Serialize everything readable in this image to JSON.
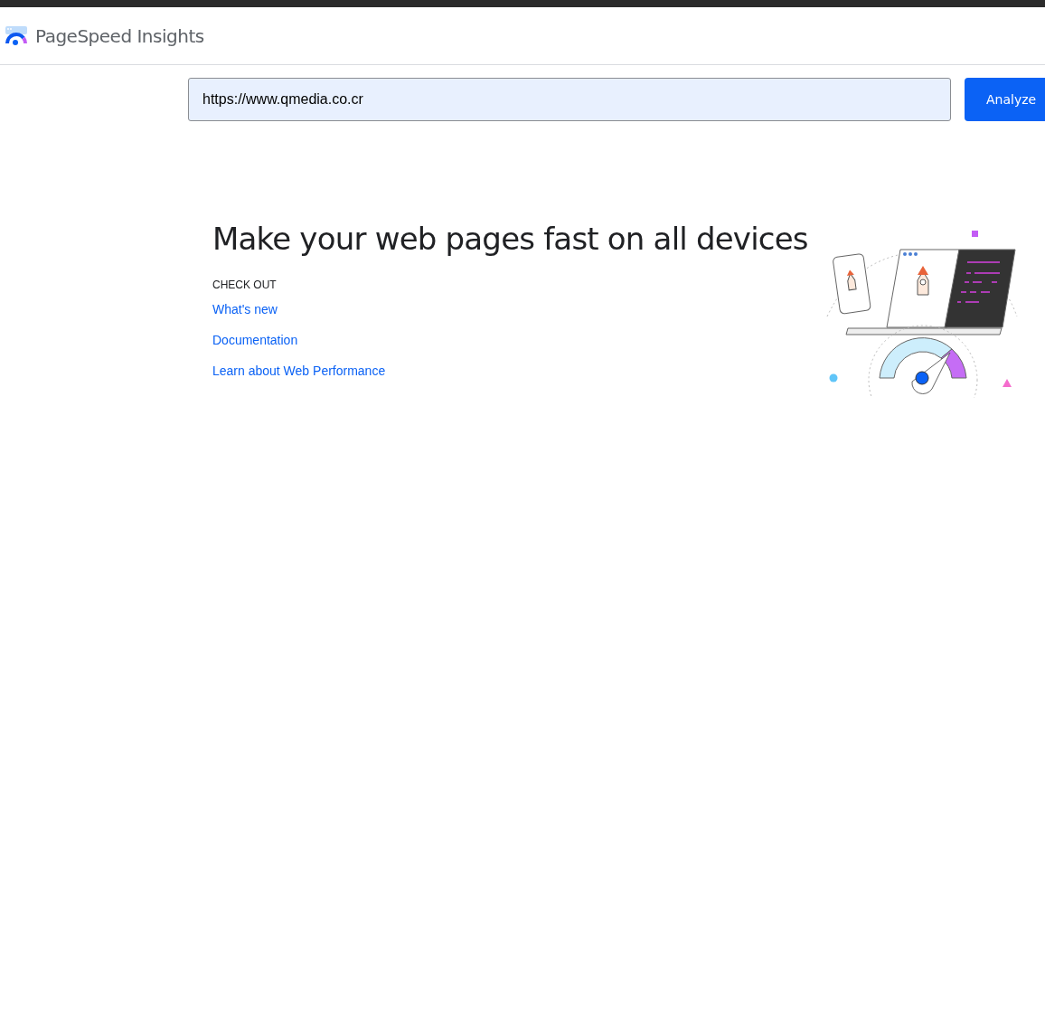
{
  "header": {
    "title": "PageSpeed Insights"
  },
  "search": {
    "value": "https://www.qmedia.co.cr",
    "button": "Analyze"
  },
  "hero": {
    "heading": "Make your web pages fast on all devices",
    "section_label": "CHECK OUT",
    "links": [
      "What's new",
      "Documentation",
      "Learn about Web Performance"
    ]
  }
}
